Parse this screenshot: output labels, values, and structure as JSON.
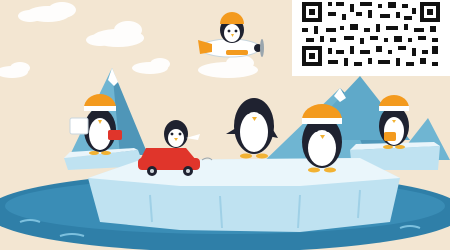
{
  "scene": {
    "colors": {
      "background": "#f3e6d2",
      "sea": "#2f7fa8",
      "sea_light": "#4a9bc4",
      "ice_top": "#e9f5fb",
      "ice_side": "#bfe2f1",
      "mountain": "#5fa9c9",
      "penguin_black": "#1f2230",
      "penguin_white": "#ffffff",
      "beak": "#f2b233",
      "car_red": "#e0352b",
      "helmet_orange": "#f39a1e"
    },
    "icons": [
      "cloud-icon",
      "airplane-icon",
      "penguin-icon",
      "car-icon",
      "iceberg-icon",
      "qr-code-icon"
    ]
  }
}
